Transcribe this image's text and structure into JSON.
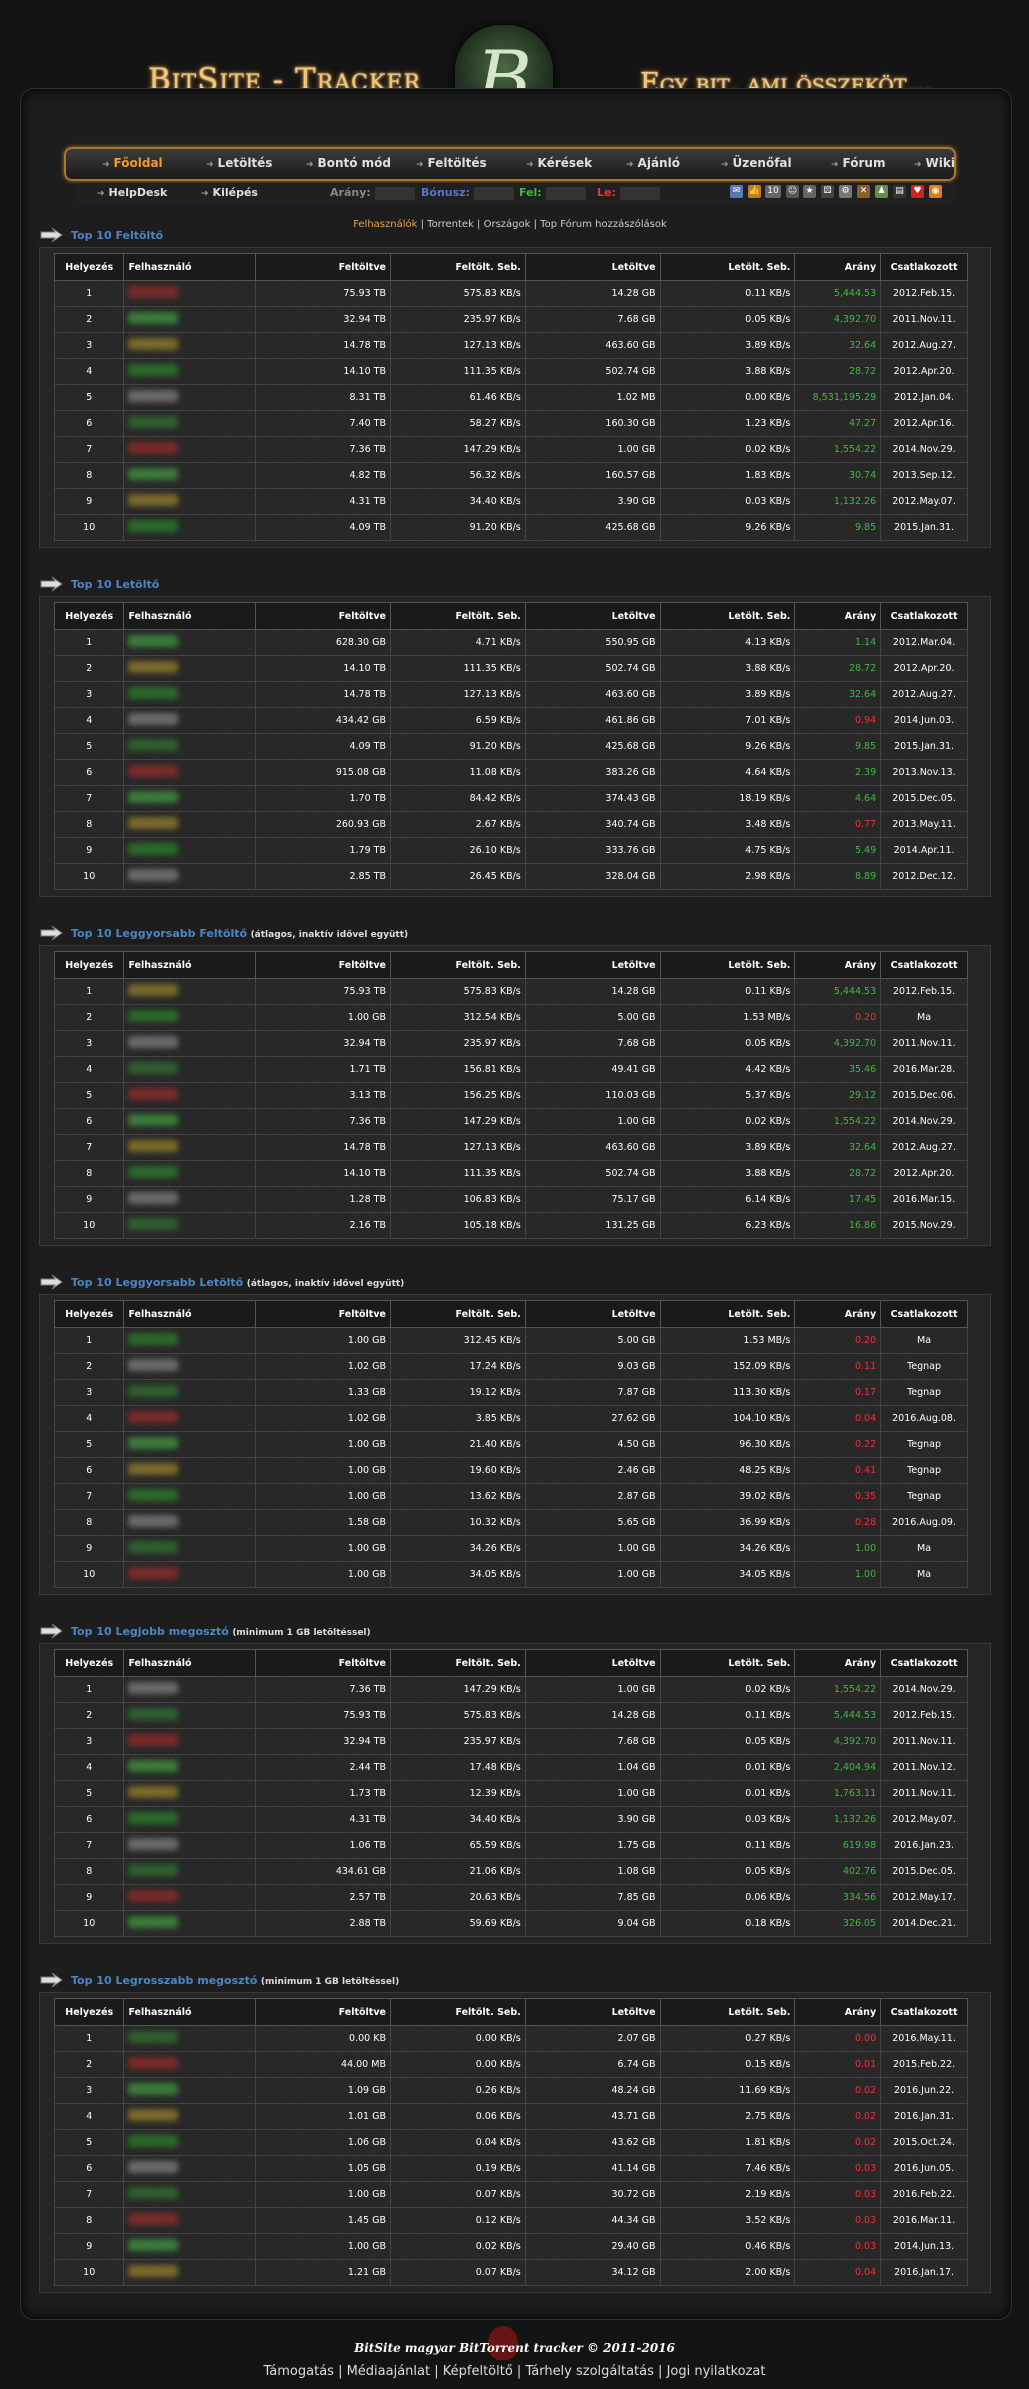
{
  "header": {
    "logo_left": "BitSite - Tracker",
    "logo_right": "Egy bit, ami összeköt...",
    "emblem": "B"
  },
  "menu": [
    {
      "label": "Főoldal",
      "active": true
    },
    {
      "label": "Letöltés"
    },
    {
      "label": "Bontó mód"
    },
    {
      "label": "Feltöltés"
    },
    {
      "label": "Kérések"
    },
    {
      "label": "Ajánló"
    },
    {
      "label": "Üzenőfal"
    },
    {
      "label": "Fórum"
    },
    {
      "label": "Wiki"
    }
  ],
  "row2": {
    "helpdesk": "HelpDesk",
    "logout": "Kilépés",
    "ratio_label": "Arány:",
    "bonus_label": "Bónusz:",
    "up_label": "Fel:",
    "down_label": "Le:",
    "badge": "10"
  },
  "subnav": {
    "users": "Felhasználók",
    "torrents": "Torrentek",
    "countries": "Országok",
    "forum": "Top Fórum hozzászólások"
  },
  "columns": [
    "Helyezés",
    "Felhasználó",
    "Feltöltve",
    "Feltölt. Seb.",
    "Letöltve",
    "Letölt. Seb.",
    "Arány",
    "Csatlakozott"
  ],
  "colors": {
    "accent": "#f09a2f",
    "link": "#4d86c4",
    "ratio_good": "#3fb93f",
    "ratio_bad": "#ee3333"
  },
  "sections": [
    {
      "title": "Top 10 Feltöltő",
      "note": "",
      "rows": [
        [
          "1",
          "75.93 TB",
          "575.83 KB/s",
          "14.28 GB",
          "0.11 KB/s",
          "5,444.53",
          "2012.Feb.15.",
          "g"
        ],
        [
          "2",
          "32.94 TB",
          "235.97 KB/s",
          "7.68 GB",
          "0.05 KB/s",
          "4,392.70",
          "2011.Nov.11.",
          "g"
        ],
        [
          "3",
          "14.78 TB",
          "127.13 KB/s",
          "463.60 GB",
          "3.89 KB/s",
          "32.64",
          "2012.Aug.27.",
          "g"
        ],
        [
          "4",
          "14.10 TB",
          "111.35 KB/s",
          "502.74 GB",
          "3.88 KB/s",
          "28.72",
          "2012.Apr.20.",
          "g"
        ],
        [
          "5",
          "8.31 TB",
          "61.46 KB/s",
          "1.02 MB",
          "0.00 KB/s",
          "8,531,195.29",
          "2012.Jan.04.",
          "g"
        ],
        [
          "6",
          "7.40 TB",
          "58.27 KB/s",
          "160.30 GB",
          "1.23 KB/s",
          "47.27",
          "2012.Apr.16.",
          "g"
        ],
        [
          "7",
          "7.36 TB",
          "147.29 KB/s",
          "1.00 GB",
          "0.02 KB/s",
          "1,554.22",
          "2014.Nov.29.",
          "g"
        ],
        [
          "8",
          "4.82 TB",
          "56.32 KB/s",
          "160.57 GB",
          "1.83 KB/s",
          "30.74",
          "2013.Sep.12.",
          "g"
        ],
        [
          "9",
          "4.31 TB",
          "34.40 KB/s",
          "3.90 GB",
          "0.03 KB/s",
          "1,132.26",
          "2012.May.07.",
          "g"
        ],
        [
          "10",
          "4.09 TB",
          "91.20 KB/s",
          "425.68 GB",
          "9.26 KB/s",
          "9.85",
          "2015.Jan.31.",
          "g"
        ]
      ]
    },
    {
      "title": "Top 10 Letöltő",
      "note": "",
      "rows": [
        [
          "1",
          "628.30 GB",
          "4.71 KB/s",
          "550.95 GB",
          "4.13 KB/s",
          "1.14",
          "2012.Mar.04.",
          "g"
        ],
        [
          "2",
          "14.10 TB",
          "111.35 KB/s",
          "502.74 GB",
          "3.88 KB/s",
          "28.72",
          "2012.Apr.20.",
          "g"
        ],
        [
          "3",
          "14.78 TB",
          "127.13 KB/s",
          "463.60 GB",
          "3.89 KB/s",
          "32.64",
          "2012.Aug.27.",
          "g"
        ],
        [
          "4",
          "434.42 GB",
          "6.59 KB/s",
          "461.86 GB",
          "7.01 KB/s",
          "0.94",
          "2014.Jun.03.",
          "rd"
        ],
        [
          "5",
          "4.09 TB",
          "91.20 KB/s",
          "425.68 GB",
          "9.26 KB/s",
          "9.85",
          "2015.Jan.31.",
          "g"
        ],
        [
          "6",
          "915.08 GB",
          "11.08 KB/s",
          "383.26 GB",
          "4.64 KB/s",
          "2.39",
          "2013.Nov.13.",
          "g"
        ],
        [
          "7",
          "1.70 TB",
          "84.42 KB/s",
          "374.43 GB",
          "18.19 KB/s",
          "4.64",
          "2015.Dec.05.",
          "g"
        ],
        [
          "8",
          "260.93 GB",
          "2.67 KB/s",
          "340.74 GB",
          "3.48 KB/s",
          "0.77",
          "2013.May.11.",
          "rd"
        ],
        [
          "9",
          "1.79 TB",
          "26.10 KB/s",
          "333.76 GB",
          "4.75 KB/s",
          "5.49",
          "2014.Apr.11.",
          "g"
        ],
        [
          "10",
          "2.85 TB",
          "26.45 KB/s",
          "328.04 GB",
          "2.98 KB/s",
          "8.89",
          "2012.Dec.12.",
          "g"
        ]
      ]
    },
    {
      "title": "Top 10 Leggyorsabb Feltöltő",
      "note": "(átlagos, inaktív idővel együtt)",
      "rows": [
        [
          "1",
          "75.93 TB",
          "575.83 KB/s",
          "14.28 GB",
          "0.11 KB/s",
          "5,444.53",
          "2012.Feb.15.",
          "g"
        ],
        [
          "2",
          "1.00 GB",
          "312.54 KB/s",
          "5.00 GB",
          "1.53 MB/s",
          "0.20",
          "Ma",
          "rd"
        ],
        [
          "3",
          "32.94 TB",
          "235.97 KB/s",
          "7.68 GB",
          "0.05 KB/s",
          "4,392.70",
          "2011.Nov.11.",
          "g"
        ],
        [
          "4",
          "1.71 TB",
          "156.81 KB/s",
          "49.41 GB",
          "4.42 KB/s",
          "35.46",
          "2016.Mar.28.",
          "g"
        ],
        [
          "5",
          "3.13 TB",
          "156.25 KB/s",
          "110.03 GB",
          "5.37 KB/s",
          "29.12",
          "2015.Dec.06.",
          "g"
        ],
        [
          "6",
          "7.36 TB",
          "147.29 KB/s",
          "1.00 GB",
          "0.02 KB/s",
          "1,554.22",
          "2014.Nov.29.",
          "g"
        ],
        [
          "7",
          "14.78 TB",
          "127.13 KB/s",
          "463.60 GB",
          "3.89 KB/s",
          "32.64",
          "2012.Aug.27.",
          "g"
        ],
        [
          "8",
          "14.10 TB",
          "111.35 KB/s",
          "502.74 GB",
          "3.88 KB/s",
          "28.72",
          "2012.Apr.20.",
          "g"
        ],
        [
          "9",
          "1.28 TB",
          "106.83 KB/s",
          "75.17 GB",
          "6.14 KB/s",
          "17.45",
          "2016.Mar.15.",
          "g"
        ],
        [
          "10",
          "2.16 TB",
          "105.18 KB/s",
          "131.25 GB",
          "6.23 KB/s",
          "16.86",
          "2015.Nov.29.",
          "g"
        ]
      ]
    },
    {
      "title": "Top 10 Leggyorsabb Letöltő",
      "note": "(átlagos, inaktív idővel együtt)",
      "rows": [
        [
          "1",
          "1.00 GB",
          "312.45 KB/s",
          "5.00 GB",
          "1.53 MB/s",
          "0.20",
          "Ma",
          "rd"
        ],
        [
          "2",
          "1.02 GB",
          "17.24 KB/s",
          "9.03 GB",
          "152.09 KB/s",
          "0.11",
          "Tegnap",
          "rd"
        ],
        [
          "3",
          "1.33 GB",
          "19.12 KB/s",
          "7.87 GB",
          "113.30 KB/s",
          "0.17",
          "Tegnap",
          "rd"
        ],
        [
          "4",
          "1.02 GB",
          "3.85 KB/s",
          "27.62 GB",
          "104.10 KB/s",
          "0.04",
          "2016.Aug.08.",
          "rd"
        ],
        [
          "5",
          "1.00 GB",
          "21.40 KB/s",
          "4.50 GB",
          "96.30 KB/s",
          "0.22",
          "Tegnap",
          "rd"
        ],
        [
          "6",
          "1.00 GB",
          "19.60 KB/s",
          "2.46 GB",
          "48.25 KB/s",
          "0.41",
          "Tegnap",
          "rd"
        ],
        [
          "7",
          "1.00 GB",
          "13.62 KB/s",
          "2.87 GB",
          "39.02 KB/s",
          "0.35",
          "Tegnap",
          "rd"
        ],
        [
          "8",
          "1.58 GB",
          "10.32 KB/s",
          "5.65 GB",
          "36.99 KB/s",
          "0.28",
          "2016.Aug.09.",
          "rd"
        ],
        [
          "9",
          "1.00 GB",
          "34.26 KB/s",
          "1.00 GB",
          "34.26 KB/s",
          "1.00",
          "Ma",
          "g"
        ],
        [
          "10",
          "1.00 GB",
          "34.05 KB/s",
          "1.00 GB",
          "34.05 KB/s",
          "1.00",
          "Ma",
          "g"
        ]
      ]
    },
    {
      "title": "Top 10 Legjobb megosztó",
      "note": "(minimum 1 GB letöltéssel)",
      "rows": [
        [
          "1",
          "7.36 TB",
          "147.29 KB/s",
          "1.00 GB",
          "0.02 KB/s",
          "1,554.22",
          "2014.Nov.29.",
          "g"
        ],
        [
          "2",
          "75.93 TB",
          "575.83 KB/s",
          "14.28 GB",
          "0.11 KB/s",
          "5,444.53",
          "2012.Feb.15.",
          "g"
        ],
        [
          "3",
          "32.94 TB",
          "235.97 KB/s",
          "7.68 GB",
          "0.05 KB/s",
          "4,392.70",
          "2011.Nov.11.",
          "g"
        ],
        [
          "4",
          "2.44 TB",
          "17.48 KB/s",
          "1.04 GB",
          "0.01 KB/s",
          "2,404.94",
          "2011.Nov.12.",
          "g"
        ],
        [
          "5",
          "1.73 TB",
          "12.39 KB/s",
          "1.00 GB",
          "0.01 KB/s",
          "1,763.11",
          "2011.Nov.11.",
          "g"
        ],
        [
          "6",
          "4.31 TB",
          "34.40 KB/s",
          "3.90 GB",
          "0.03 KB/s",
          "1,132.26",
          "2012.May.07.",
          "g"
        ],
        [
          "7",
          "1.06 TB",
          "65.59 KB/s",
          "1.75 GB",
          "0.11 KB/s",
          "619.98",
          "2016.Jan.23.",
          "g"
        ],
        [
          "8",
          "434.61 GB",
          "21.06 KB/s",
          "1.08 GB",
          "0.05 KB/s",
          "402.76",
          "2015.Dec.05.",
          "g"
        ],
        [
          "9",
          "2.57 TB",
          "20.63 KB/s",
          "7.85 GB",
          "0.06 KB/s",
          "334.56",
          "2012.May.17.",
          "g"
        ],
        [
          "10",
          "2.88 TB",
          "59.69 KB/s",
          "9.04 GB",
          "0.18 KB/s",
          "326.05",
          "2014.Dec.21.",
          "g"
        ]
      ]
    },
    {
      "title": "Top 10 Legrosszabb megosztó",
      "note": "(minimum 1 GB letöltéssel)",
      "rows": [
        [
          "1",
          "0.00 KB",
          "0.00 KB/s",
          "2.07 GB",
          "0.27 KB/s",
          "0.00",
          "2016.May.11.",
          "rd"
        ],
        [
          "2",
          "44.00 MB",
          "0.00 KB/s",
          "6.74 GB",
          "0.15 KB/s",
          "0.01",
          "2015.Feb.22.",
          "rd"
        ],
        [
          "3",
          "1.09 GB",
          "0.26 KB/s",
          "48.24 GB",
          "11.69 KB/s",
          "0.02",
          "2016.Jun.22.",
          "rd"
        ],
        [
          "4",
          "1.01 GB",
          "0.06 KB/s",
          "43.71 GB",
          "2.75 KB/s",
          "0.02",
          "2016.Jan.31.",
          "rd"
        ],
        [
          "5",
          "1.06 GB",
          "0.04 KB/s",
          "43.62 GB",
          "1.81 KB/s",
          "0.02",
          "2015.Oct.24.",
          "rd"
        ],
        [
          "6",
          "1.05 GB",
          "0.19 KB/s",
          "41.14 GB",
          "7.46 KB/s",
          "0.03",
          "2016.Jun.05.",
          "rd"
        ],
        [
          "7",
          "1.00 GB",
          "0.07 KB/s",
          "30.72 GB",
          "2.19 KB/s",
          "0.03",
          "2016.Feb.22.",
          "rd"
        ],
        [
          "8",
          "1.45 GB",
          "0.12 KB/s",
          "44.34 GB",
          "3.52 KB/s",
          "0.03",
          "2016.Mar.11.",
          "rd"
        ],
        [
          "9",
          "1.00 GB",
          "0.02 KB/s",
          "29.40 GB",
          "0.46 KB/s",
          "0.03",
          "2014.Jun.13.",
          "rd"
        ],
        [
          "10",
          "1.21 GB",
          "0.07 KB/s",
          "34.12 GB",
          "2.00 KB/s",
          "0.04",
          "2016.Jan.17.",
          "rd"
        ]
      ]
    }
  ],
  "footer": {
    "copyright": "BitSite magyar BitTorrent tracker © 2011-2016",
    "links": [
      "Támogatás",
      "Médiaajánlat",
      "Képfeltöltő",
      "Tárhely szolgáltatás",
      "Jogi nyilatkozat"
    ]
  }
}
